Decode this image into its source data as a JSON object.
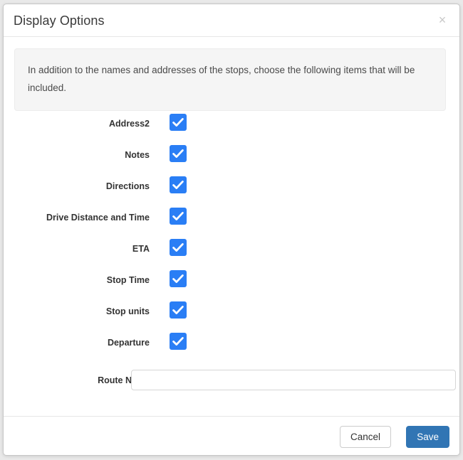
{
  "modal": {
    "title": "Display Options",
    "close_icon": "close-icon",
    "info_text": "In addition to the names and addresses of the stops, choose the following items that will be included.",
    "options": [
      {
        "label": "Address2",
        "checked": true
      },
      {
        "label": "Notes",
        "checked": true
      },
      {
        "label": "Directions",
        "checked": true
      },
      {
        "label": "Drive Distance and Time",
        "checked": true
      },
      {
        "label": "ETA",
        "checked": true
      },
      {
        "label": "Stop Time",
        "checked": true
      },
      {
        "label": "Stop units",
        "checked": true
      },
      {
        "label": "Departure",
        "checked": true
      }
    ],
    "route_name": {
      "label": "Route Name",
      "value": "",
      "placeholder": ""
    },
    "footer": {
      "cancel_label": "Cancel",
      "save_label": "Save"
    }
  },
  "colors": {
    "checkbox_blue": "#2a7ef5",
    "save_blue": "#3175b4",
    "info_background": "#f5f5f5",
    "border_gray": "#e6e6e6"
  }
}
